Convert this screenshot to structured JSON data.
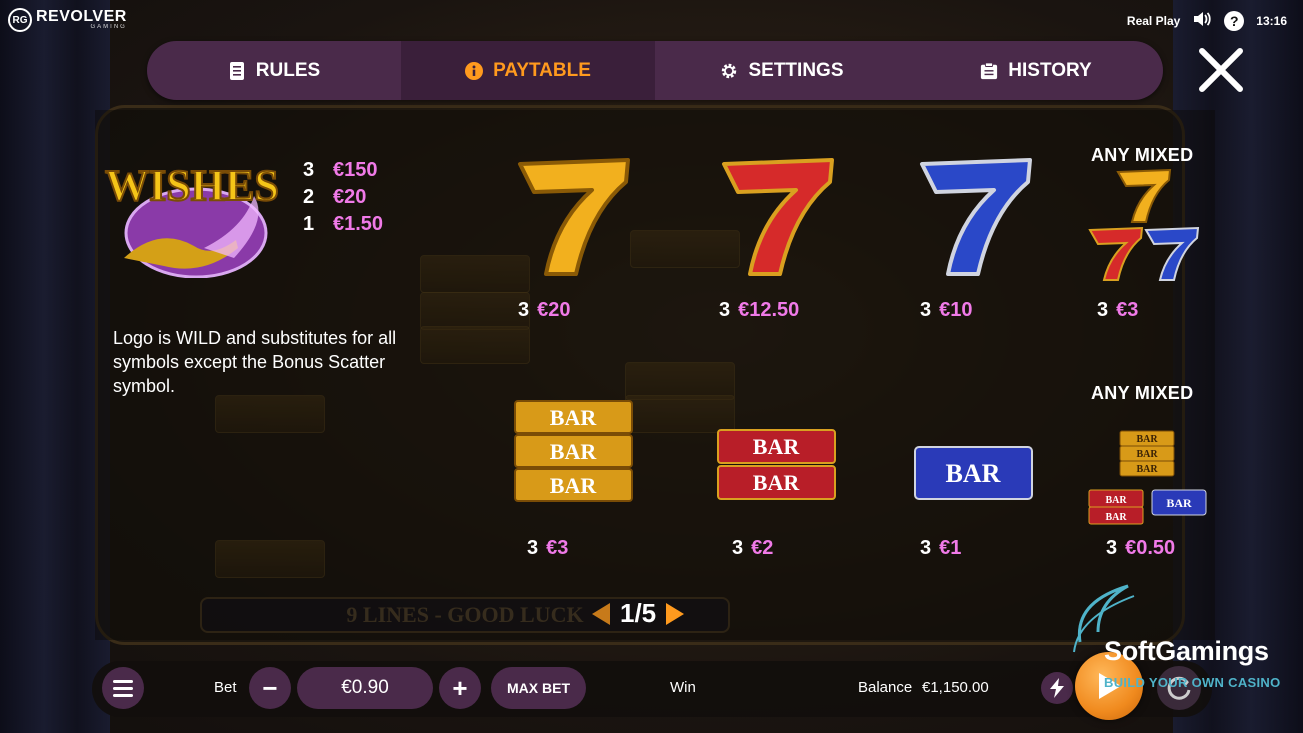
{
  "brand": {
    "badge": "RG",
    "name": "REVOLVER",
    "sub": "GAMING"
  },
  "status": {
    "mode": "Real Play",
    "time": "13:16",
    "sound_icon": "speaker-icon",
    "help_icon": "question-icon",
    "help_label": "?"
  },
  "tabs": [
    {
      "label": "RULES",
      "icon": "document-icon",
      "active": false
    },
    {
      "label": "PAYTABLE",
      "icon": "info-icon",
      "active": true
    },
    {
      "label": "SETTINGS",
      "icon": "gear-icon",
      "active": false
    },
    {
      "label": "HISTORY",
      "icon": "clipboard-icon",
      "active": false
    }
  ],
  "wild": {
    "logo_text": "WISHES",
    "pays": [
      {
        "count": "3",
        "value": "€150"
      },
      {
        "count": "2",
        "value": "€20"
      },
      {
        "count": "1",
        "value": "€1.50"
      }
    ],
    "description": "Logo is WILD and substitutes for all symbols except the Bonus Scatter symbol."
  },
  "paytable": {
    "row1": [
      {
        "symbol": "gold-seven",
        "count": "3",
        "value": "€20"
      },
      {
        "symbol": "red-seven",
        "count": "3",
        "value": "€12.50"
      },
      {
        "symbol": "blue-seven",
        "count": "3",
        "value": "€10"
      },
      {
        "symbol": "any-mixed-sevens",
        "heading": "ANY MIXED",
        "count": "3",
        "value": "€3"
      }
    ],
    "row2": [
      {
        "symbol": "triple-bar",
        "count": "3",
        "value": "€3"
      },
      {
        "symbol": "double-bar",
        "count": "3",
        "value": "€2"
      },
      {
        "symbol": "single-bar",
        "count": "3",
        "value": "€1"
      },
      {
        "symbol": "any-mixed-bars",
        "heading": "ANY MIXED",
        "count": "3",
        "value": "€0.50"
      }
    ],
    "bar_text": "BAR",
    "page": "1/5"
  },
  "background": {
    "lines_text": "9 LINES - GOOD LUCK"
  },
  "bottom": {
    "bet_label": "Bet",
    "bet_value": "€0.90",
    "minus": "−",
    "plus": "+",
    "max_bet": "MAX BET",
    "win_label": "Win",
    "balance_label": "Balance",
    "balance_value": "€1,150.00"
  },
  "watermark": {
    "title": "SoftGamings",
    "subtitle": "BUILD YOUR OWN CASINO"
  },
  "colors": {
    "accent": "#ff9a1e",
    "payout": "#f07ae8",
    "tab_bg": "#4a2a4a",
    "tab_active_bg": "#3a1f3a"
  }
}
